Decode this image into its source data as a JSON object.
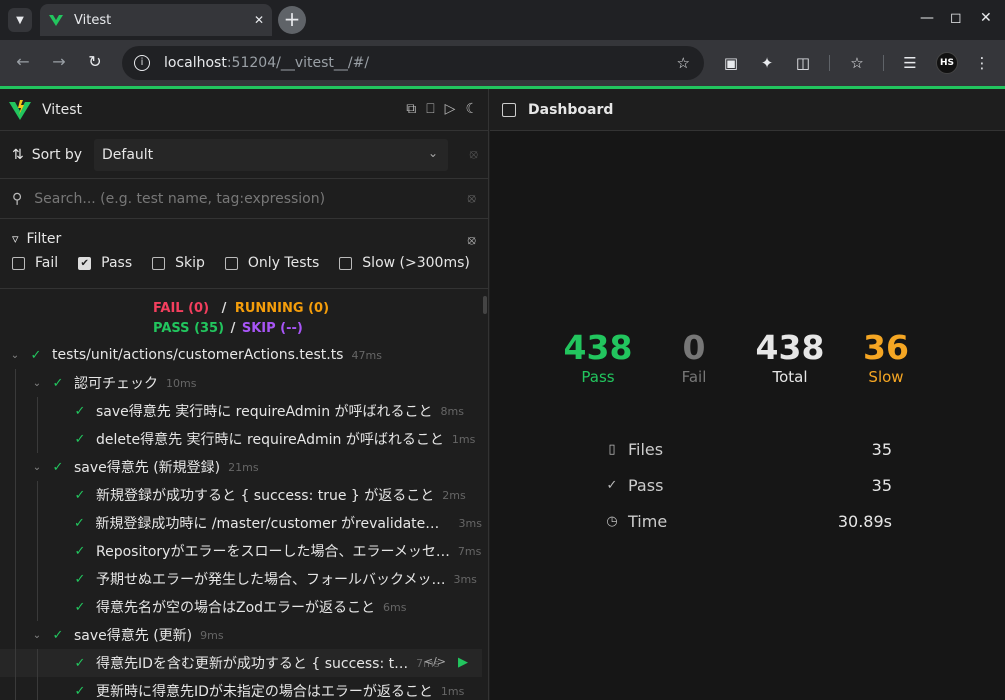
{
  "browser": {
    "tab_title": "Vitest",
    "url_host": "localhost",
    "url_path": ":51204/__vitest__/#/",
    "profile_initials": "HS"
  },
  "app": {
    "title": "Vitest",
    "dashboard_title": "Dashboard"
  },
  "sort": {
    "label": "Sort by",
    "value": "Default"
  },
  "search": {
    "placeholder": "Search... (e.g. test name, tag:expression)"
  },
  "filter": {
    "label": "Filter",
    "options": [
      {
        "label": "Fail",
        "checked": false
      },
      {
        "label": "Pass",
        "checked": true
      },
      {
        "label": "Skip",
        "checked": false
      },
      {
        "label": "Only Tests",
        "checked": false
      },
      {
        "label": "Slow (>300ms)",
        "checked": false
      }
    ]
  },
  "summary": {
    "fail": "FAIL (0)",
    "running": "RUNNING (0)",
    "pass": "PASS (35)",
    "skip": "SKIP (--)",
    "sep": "/"
  },
  "tree": [
    {
      "level": 0,
      "name": "tests/unit/actions/customerActions.test.ts",
      "duration": "47ms",
      "caret": true
    },
    {
      "level": 1,
      "name": "認可チェック",
      "duration": "10ms",
      "caret": true
    },
    {
      "level": 2,
      "name": "save得意先 実行時に requireAdmin が呼ばれること",
      "duration": "8ms",
      "caret": false
    },
    {
      "level": 2,
      "name": "delete得意先 実行時に requireAdmin が呼ばれること",
      "duration": "1ms",
      "caret": false
    },
    {
      "level": 1,
      "name": "save得意先 (新規登録)",
      "duration": "21ms",
      "caret": true
    },
    {
      "level": 2,
      "name": "新規登録が成功すると { success: true } が返ること",
      "duration": "2ms",
      "caret": false
    },
    {
      "level": 2,
      "name": "新規登録成功時に /master/customer がrevalidateさ…",
      "duration": "3ms",
      "caret": false
    },
    {
      "level": 2,
      "name": "Repositoryがエラーをスローした場合、エラーメッセ…",
      "duration": "7ms",
      "caret": false
    },
    {
      "level": 2,
      "name": "予期せぬエラーが発生した場合、フォールバックメッ…",
      "duration": "3ms",
      "caret": false
    },
    {
      "level": 2,
      "name": "得意先名が空の場合はZodエラーが返ること",
      "duration": "6ms",
      "caret": false
    },
    {
      "level": 1,
      "name": "save得意先 (更新)",
      "duration": "9ms",
      "caret": true
    },
    {
      "level": 2,
      "name": "得意先IDを含む更新が成功すると { success: t…",
      "duration": "7ms",
      "caret": false,
      "highlight": true
    },
    {
      "level": 2,
      "name": "更新時に得意先IDが未指定の場合はエラーが返ること",
      "duration": "1ms",
      "caret": false
    }
  ],
  "stats": [
    {
      "value": "438",
      "label": "Pass",
      "color": "#22c55e",
      "label_color": "#22c55e"
    },
    {
      "value": "0",
      "label": "Fail",
      "color": "#777777",
      "label_color": "#777777"
    },
    {
      "value": "438",
      "label": "Total",
      "color": "#e6e6e6",
      "label_color": "#e6e6e6"
    },
    {
      "value": "36",
      "label": "Slow",
      "color": "#f5a623",
      "label_color": "#f5a623"
    }
  ],
  "details": [
    {
      "icon": "file-icon",
      "label": "Files",
      "value": "35"
    },
    {
      "icon": "check-icon",
      "label": "Pass",
      "value": "35"
    },
    {
      "icon": "stopwatch-icon",
      "label": "Time",
      "value": "30.89s"
    }
  ],
  "colors": {
    "accent": "#22c55e",
    "fail": "#f43f5e",
    "running": "#f59e0b",
    "skip": "#a855f7"
  }
}
